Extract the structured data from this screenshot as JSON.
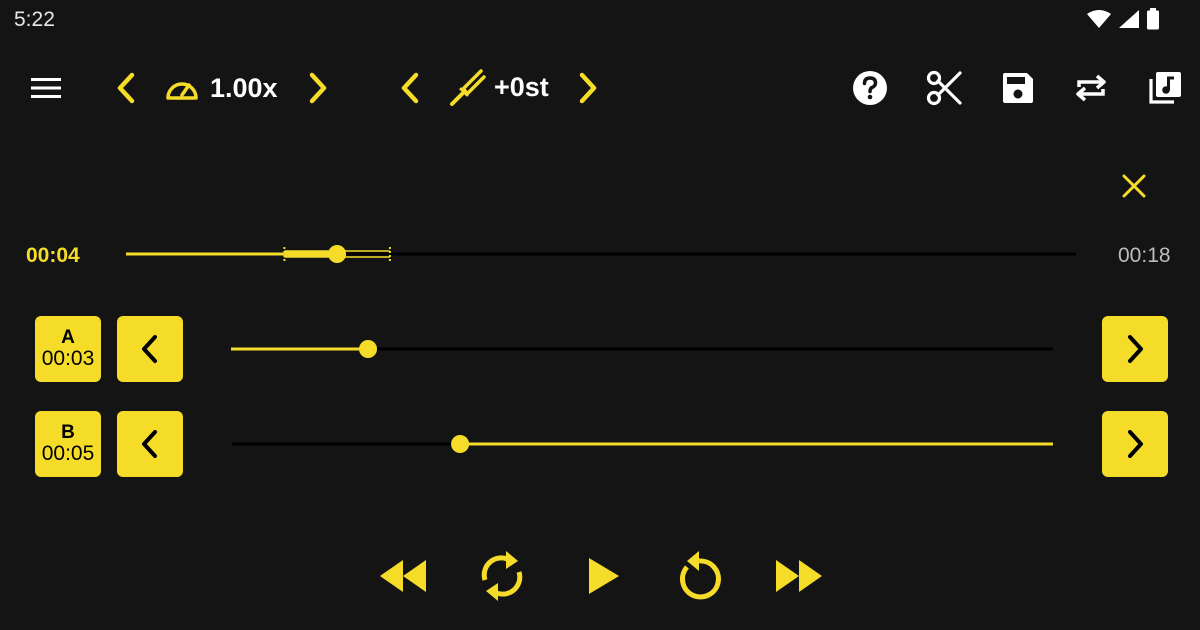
{
  "status_bar": {
    "time": "5:22"
  },
  "toolbar": {
    "speed_value": "1.00x",
    "pitch_value": "+0st"
  },
  "playback": {
    "current_time": "00:04",
    "total_time": "00:18",
    "progress_fraction": 0.2222
  },
  "loop_a": {
    "label": "A",
    "time": "00:03",
    "position_fraction": 0.1667
  },
  "loop_b": {
    "label": "B",
    "time": "00:05",
    "position_fraction": 0.2778
  },
  "colors": {
    "accent": "#f5dc28",
    "background": "#141414",
    "text": "#ffffff",
    "muted": "#bdbdbd"
  }
}
